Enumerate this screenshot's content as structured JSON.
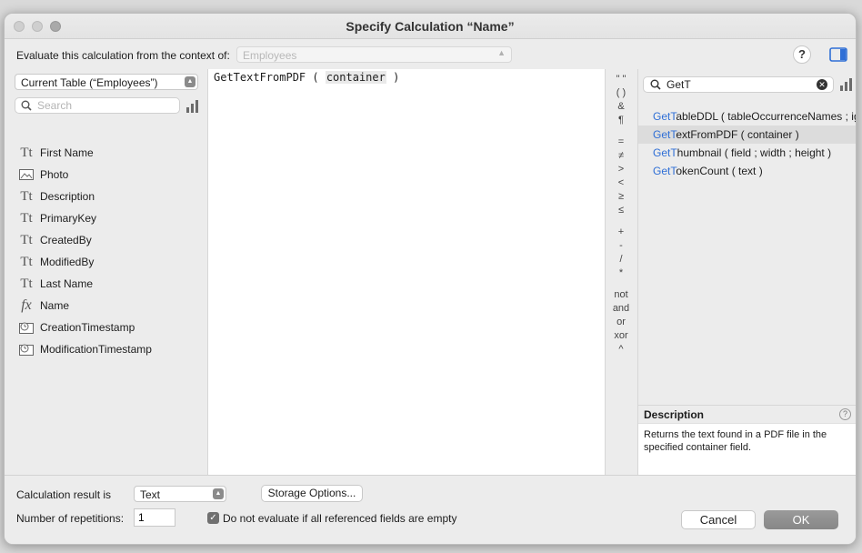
{
  "window": {
    "title": "Specify Calculation “Name”"
  },
  "context": {
    "label": "Evaluate this calculation from the context of:",
    "selected": "Employees",
    "help": "?"
  },
  "left": {
    "table_select": "Current Table (“Employees”)",
    "search_placeholder": "Search",
    "fields": [
      {
        "name": "First Name",
        "type": "text"
      },
      {
        "name": "Photo",
        "type": "container"
      },
      {
        "name": "Description",
        "type": "text"
      },
      {
        "name": "PrimaryKey",
        "type": "text"
      },
      {
        "name": "CreatedBy",
        "type": "text"
      },
      {
        "name": "ModifiedBy",
        "type": "text"
      },
      {
        "name": "Last Name",
        "type": "text"
      },
      {
        "name": "Name",
        "type": "calculation"
      },
      {
        "name": "CreationTimestamp",
        "type": "timestamp"
      },
      {
        "name": "ModificationTimestamp",
        "type": "timestamp"
      }
    ]
  },
  "editor": {
    "func": "GetTextFromPDF ( ",
    "param": "container",
    "close": " )"
  },
  "operators": [
    "\" \"",
    "( )",
    "&",
    "¶",
    "=",
    "≠",
    ">",
    "<",
    "≥",
    "≤",
    "+",
    "-",
    "/",
    "*",
    "not",
    "and",
    "or",
    "xor",
    "^"
  ],
  "functions": {
    "search_value": "GetT",
    "items": [
      {
        "prefix": "GetT",
        "rest": "ableDDL ( tableOccurrenceNames ; ignoreError )",
        "selected": false
      },
      {
        "prefix": "GetT",
        "rest": "extFromPDF ( container )",
        "selected": true
      },
      {
        "prefix": "GetT",
        "rest": "humbnail ( field ; width ; height )",
        "selected": false
      },
      {
        "prefix": "GetT",
        "rest": "okenCount ( text )",
        "selected": false
      }
    ]
  },
  "description": {
    "title": "Description",
    "text": "Returns the text found in a PDF file in the specified container field."
  },
  "bottom": {
    "result_label": "Calculation result is",
    "result_value": "Text",
    "storage_button": "Storage Options...",
    "repetitions_label": "Number of repetitions:",
    "repetitions_value": "1",
    "checkbox_label": "Do not evaluate if all referenced fields are empty",
    "cancel": "Cancel",
    "ok": "OK"
  },
  "colors": {
    "highlight": "#2f6fd6",
    "ok_button": "#8f8f8f"
  }
}
